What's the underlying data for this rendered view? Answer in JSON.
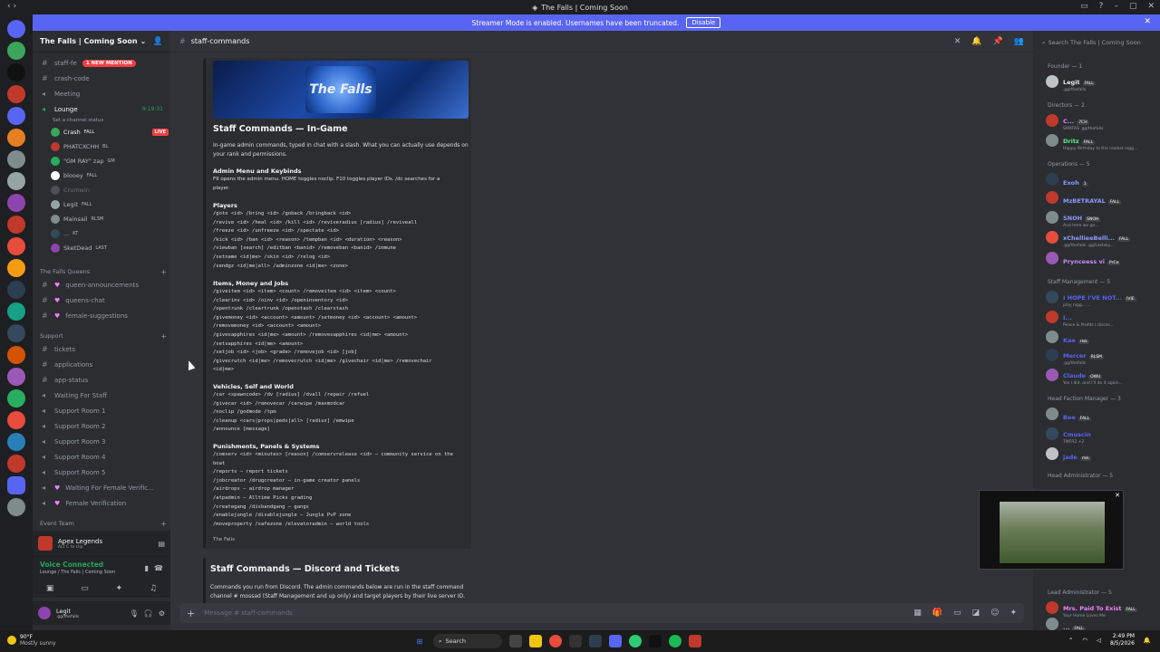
{
  "window": {
    "title": "The Falls | Coming Soon"
  },
  "banner": {
    "text": "Streamer Mode is enabled. Usernames have been truncated.",
    "button": "Disable"
  },
  "server": {
    "name": "The Falls | Coming Soon",
    "channels": [
      {
        "name": "staff-fe",
        "badge": "1 NEW MENTION"
      },
      {
        "name": "crash-code"
      },
      {
        "name": "Meeting"
      }
    ],
    "lounge": {
      "name": "Lounge",
      "timer": "9:19:31",
      "status": "Set a channel status"
    },
    "voice_users": [
      {
        "name": "Crash",
        "tag": "FALL",
        "live": "LIVE"
      },
      {
        "name": "PHATCXCHH",
        "tag": "BL"
      },
      {
        "name": "\"GM RAY\" zap",
        "tag": "GM"
      },
      {
        "name": "blooey",
        "tag": "FALL"
      },
      {
        "name": "Crumwin",
        "tag": ""
      },
      {
        "name": "Legit",
        "tag": "FALL"
      },
      {
        "name": "Mainsail",
        "tag": "RLSM"
      },
      {
        "name": "...",
        "tag": "KT"
      },
      {
        "name": "SketDead",
        "tag": "LAST"
      }
    ],
    "categories": {
      "queens": "The Falls Queens",
      "support": "Support",
      "event": "Event Team"
    },
    "queens_channels": [
      "queen-announcements",
      "queens-chat",
      "female-suggestions"
    ],
    "support_channels": [
      "tickets",
      "applications",
      "app-status",
      "Waiting For Staff",
      "Support Room 1",
      "Support Room 2",
      "Support Room 3",
      "Support Room 4",
      "Support Room 5",
      "Waiting For Female Verific...",
      "Female Verification"
    ]
  },
  "activity": {
    "game": "Apex Legends",
    "hint": "ALT  C  to clip"
  },
  "voice_panel": {
    "title": "Voice Connected",
    "subtitle": "Lounge / The Falls | Coming Soon"
  },
  "user_panel": {
    "name": "Legit",
    "sub": ".gg/thefalls"
  },
  "chat": {
    "channel": "staff-commands",
    "placeholder": "Message # staff-commands",
    "embed": {
      "logo_text": "The Falls",
      "title": "Staff Commands — In-Game",
      "description": "In-game admin commands, typed in chat with a slash. What you can actually use depends on your rank and permissions.",
      "fields": [
        {
          "name": "Admin Menu and Keybinds",
          "lines": [
            "F9 opens the admin menu. HOME toggles noclip. F10 toggles player IDs. /dc searches for a",
            "player."
          ]
        },
        {
          "name": "Players",
          "lines": [
            "/goto <id>  /bring <id>  /goback  /bringback <id>",
            "/revive <id>  /heal <id>  /kill <id>  /reviveradius [radius]  /reviveall",
            "/freeze <id>  /unfreeze <id>  /spectate <id>",
            "/kick <id>  /ban <id> <reason>  /tempban <id> <duration> <reason>",
            "/viewban [search]  /editban <banid>  /removeban <banid>  /immune",
            "/setname <id|me>  /skin <id>  /relog <id>",
            "/sendgz <id|me|all>  /adminzone <id|me> <zone>"
          ]
        },
        {
          "name": "Items, Money and Jobs",
          "lines": [
            "/giveitem <id> <item> <count>  /removeitem <id> <item> <count>",
            "/clearinv <id>  /oinv <id>  /openinventory <id>",
            "/opentrunk  /cleartrunk  /openstash  /clearstash",
            "/givemoney <id> <account> <amount>  /setmoney <id> <account> <amount>",
            "/removemoney <id> <account> <amount>",
            "/givesapphires <id|me> <amount>  /removesapphires <id|me> <amount>",
            "/setsapphires <id|me> <amount>",
            "/setjob <id> <job> <grade>  /removejob <id> [job]",
            "/givecrutch <id|me>  /removecrutch <id|me>  /givechair <id|me>  /removechair",
            "<id|me>"
          ]
        },
        {
          "name": "Vehicles, Self and World",
          "lines": [
            "/car <spawncode>  /dv [radius]  /dvall  /repair  /refuel",
            "/givecar <id>  /removecar  /carwipe  /maxmodcar",
            "/noclip  /godmode  /tpm",
            "/cleanup <cars|props|peds|all> [radius]  /emwipe",
            "/announce [message]"
          ]
        },
        {
          "name": "Punishments, Panels & Systems",
          "lines": [
            "/comserv <id> <minutes> [reason]  /comservrelease <id> — community service on the",
            "boat",
            "/reports — report tickets",
            "/jobcreator  /drugcreator — in-game creator panels",
            "/airdrops — airdrop manager",
            "/atpadmin — Alltime Picks grading",
            "/creategang  /disbandgang — gangs",
            "/enablejungle  /disablejungle — Jungle PvP zone",
            "/moveproperty  /safezone  /elevatoradmin — world tools"
          ]
        }
      ],
      "footer": "The Falls"
    },
    "msg2": {
      "title": "Staff Commands — Discord and Tickets",
      "description": "Commands you run from Discord. The admin commands below are run in the staff command channel # mossad (Staff Management and up only) and target players by their live server ID."
    }
  },
  "members": {
    "search_placeholder": "Search The Falls | Coming Soon",
    "groups": [
      {
        "role": "Founder — 1",
        "items": [
          {
            "name": "Legit",
            "tag": "FALL",
            "status": ".gg/thefalls",
            "color": "#e8e8e8"
          }
        ]
      },
      {
        "role": "Directors — 2",
        "items": [
          {
            "name": "C...",
            "tag": "7CH",
            "status": "SMATAS .gg/thefalls",
            "color": "#f47fff"
          },
          {
            "name": "Dritz",
            "tag": "FALL",
            "status": "Happy Birthday to the realest nigg...",
            "color": "#57f287"
          }
        ]
      },
      {
        "role": "Operations — 5",
        "items": [
          {
            "name": "Exoh",
            "tag": "1",
            "status": "",
            "color": "#8a9bff"
          },
          {
            "name": "MzBETRAYAL",
            "tag": "FALL",
            "status": "",
            "color": "#8a9bff"
          },
          {
            "name": "SNOH",
            "tag": "SNOH",
            "status": "And here we go...",
            "color": "#8a9bff"
          },
          {
            "name": "xChellieeBelli...",
            "tag": "FALL",
            "status": ".gg/thefalls .gg/Lastsky...",
            "color": "#8a9bff"
          },
          {
            "name": "Prynceess vi",
            "tag": "PrCe",
            "status": "",
            "color": "#c58bff"
          }
        ]
      },
      {
        "role": "Staff Management — 5",
        "items": [
          {
            "name": "I HOPE I'VE NOT...",
            "tag": "IVIE",
            "status": "play nigg... ...",
            "color": "#5865f2"
          },
          {
            "name": "I...",
            "tag": "",
            "status": "Peace & Profits  I discor...",
            "color": "#5865f2"
          },
          {
            "name": "Kae",
            "tag": "rlsk",
            "status": "",
            "color": "#5865f2"
          },
          {
            "name": "Mercer",
            "tag": "RLSM",
            "status": ".gg/thefalls",
            "color": "#5865f2"
          },
          {
            "name": "Claude",
            "tag": "OWU",
            "status": "Yes I did, and I'll do it again...",
            "color": "#5865f2"
          }
        ]
      },
      {
        "role": "Head Faction Manager — 3",
        "items": [
          {
            "name": "Bee",
            "tag": "FALL",
            "status": "",
            "color": "#5865f2"
          },
          {
            "name": "Cmuscin",
            "tag": "",
            "status": "TMFR2 +2",
            "color": "#5865f2"
          },
          {
            "name": "jade",
            "tag": "rlsk",
            "status": "",
            "color": "#5865f2"
          }
        ]
      },
      {
        "role": "Head Administrator — 5",
        "items": []
      },
      {
        "role": "Lead Administrator — 5",
        "items": [
          {
            "name": "Mrs. Paid To Exist",
            "tag": "FALL",
            "status": "Your Home Loves Me",
            "color": "#f47fff"
          },
          {
            "name": "...",
            "tag": "FALL",
            "status": "",
            "color": "#f47fff"
          }
        ]
      }
    ]
  },
  "taskbar": {
    "weather_temp": "90°F",
    "weather_desc": "Mostly sunny",
    "search": "Search",
    "time": "2:49 PM",
    "date": "8/5/2026"
  },
  "colors": {
    "accent": "#5865f2",
    "online": "#23a55a",
    "danger": "#f23f43"
  }
}
